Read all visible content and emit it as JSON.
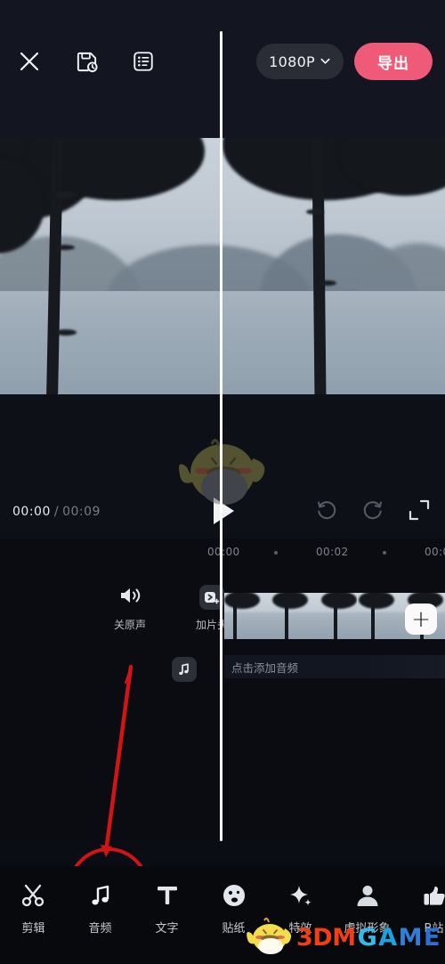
{
  "app": {
    "name": "video-editor",
    "accent_pink": "#ef5a78",
    "annotation_red": "#c81a1a",
    "background": "#0b0d14"
  },
  "topbar": {
    "close_icon": "close-x-icon",
    "save_icon": "save-draft-clock-icon",
    "list_icon": "list-menu-icon",
    "resolution_label": "1080P",
    "resolution_caret": "chevron-down-icon",
    "export_label": "导出"
  },
  "preview": {
    "scene_description": "misty lake with silhouetted pine trees",
    "watermark_icon": "bird-mascot-watermark"
  },
  "player": {
    "current_time": "00:00",
    "separator": "/",
    "total_time": "00:09",
    "play_icon": "play-triangle-icon",
    "undo_icon": "undo-arrow-icon",
    "redo_icon": "redo-arrow-icon",
    "fullscreen_icon": "fullscreen-expand-icon"
  },
  "timeline": {
    "ruler_ticks": [
      "00:00",
      "00:02",
      "00:0"
    ],
    "tools": [
      {
        "icon": "speaker-mute-icon",
        "label": "关原声"
      },
      {
        "icon": "video-add-intro-icon",
        "label": "加片头"
      }
    ],
    "audio_button_icon": "music-note-square-icon",
    "add_clip_label": "+",
    "add_clip_icon": "plus-icon",
    "audio_track_placeholder": "点击添加音频",
    "playhead_icon": "playhead-line"
  },
  "bottombar": {
    "items": [
      {
        "icon": "scissors-icon",
        "label": "剪辑",
        "highlighted": false
      },
      {
        "icon": "music-note-icon",
        "label": "音频",
        "highlighted": true
      },
      {
        "icon": "text-t-icon",
        "label": "文字",
        "highlighted": false
      },
      {
        "icon": "sticker-face-icon",
        "label": "贴纸",
        "highlighted": false
      },
      {
        "icon": "sparkle-star-icon",
        "label": "特效",
        "highlighted": false
      },
      {
        "icon": "person-avatar-icon",
        "label": "虚拟形象",
        "highlighted": false
      },
      {
        "icon": "thumbs-up-icon",
        "label": "B站",
        "highlighted": false
      }
    ]
  },
  "watermark": {
    "text_3dm": "3DM",
    "text_g": "G",
    "text_a": "A",
    "text_m": "M",
    "text_e": "E",
    "mascot_icon": "yellow-bird-mascot-icon"
  }
}
